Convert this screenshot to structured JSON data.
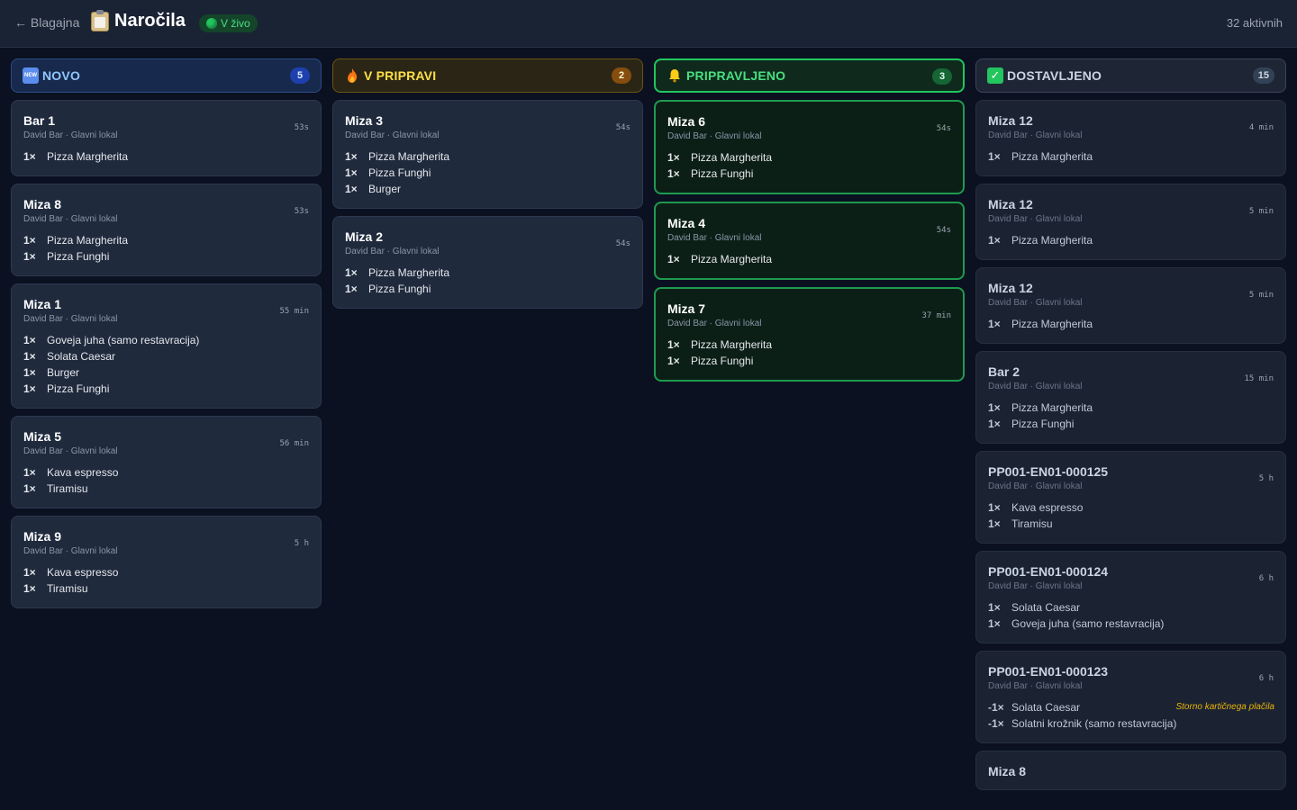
{
  "header": {
    "back_label": "← Blagajna",
    "title": "Naročila",
    "live_label": "V živo",
    "active_count": "32 aktivnih"
  },
  "columns": [
    {
      "label": "NOVO",
      "count": "5",
      "icon": "new-icon",
      "cards": [
        {
          "title": "Bar 1",
          "sub": "David Bar · Glavni lokal",
          "time": "53s",
          "items": [
            {
              "qty": "1×",
              "name": "Pizza Margherita"
            }
          ]
        },
        {
          "title": "Miza 8",
          "sub": "David Bar · Glavni lokal",
          "time": "53s",
          "items": [
            {
              "qty": "1×",
              "name": "Pizza Margherita"
            },
            {
              "qty": "1×",
              "name": "Pizza Funghi"
            }
          ]
        },
        {
          "title": "Miza 1",
          "sub": "David Bar · Glavni lokal",
          "time": "55 min",
          "items": [
            {
              "qty": "1×",
              "name": "Goveja juha (samo restavracija)"
            },
            {
              "qty": "1×",
              "name": "Solata Caesar"
            },
            {
              "qty": "1×",
              "name": "Burger"
            },
            {
              "qty": "1×",
              "name": "Pizza Funghi"
            }
          ]
        },
        {
          "title": "Miza 5",
          "sub": "David Bar · Glavni lokal",
          "time": "56 min",
          "items": [
            {
              "qty": "1×",
              "name": "Kava espresso"
            },
            {
              "qty": "1×",
              "name": "Tiramisu"
            }
          ]
        },
        {
          "title": "Miza 9",
          "sub": "David Bar · Glavni lokal",
          "time": "5 h",
          "items": [
            {
              "qty": "1×",
              "name": "Kava espresso"
            },
            {
              "qty": "1×",
              "name": "Tiramisu"
            }
          ]
        }
      ]
    },
    {
      "label": "V PRIPRAVI",
      "count": "2",
      "icon": "fire-icon",
      "cards": [
        {
          "title": "Miza 3",
          "sub": "David Bar · Glavni lokal",
          "time": "54s",
          "items": [
            {
              "qty": "1×",
              "name": "Pizza Margherita"
            },
            {
              "qty": "1×",
              "name": "Pizza Funghi"
            },
            {
              "qty": "1×",
              "name": "Burger"
            }
          ]
        },
        {
          "title": "Miza 2",
          "sub": "David Bar · Glavni lokal",
          "time": "54s",
          "items": [
            {
              "qty": "1×",
              "name": "Pizza Margherita"
            },
            {
              "qty": "1×",
              "name": "Pizza Funghi"
            }
          ]
        }
      ]
    },
    {
      "label": "PRIPRAVLJENO",
      "count": "3",
      "icon": "bell-icon",
      "cards": [
        {
          "title": "Miza 6",
          "sub": "David Bar · Glavni lokal",
          "time": "54s",
          "items": [
            {
              "qty": "1×",
              "name": "Pizza Margherita"
            },
            {
              "qty": "1×",
              "name": "Pizza Funghi"
            }
          ]
        },
        {
          "title": "Miza 4",
          "sub": "David Bar · Glavni lokal",
          "time": "54s",
          "items": [
            {
              "qty": "1×",
              "name": "Pizza Margherita"
            }
          ]
        },
        {
          "title": "Miza 7",
          "sub": "David Bar · Glavni lokal",
          "time": "37 min",
          "items": [
            {
              "qty": "1×",
              "name": "Pizza Margherita"
            },
            {
              "qty": "1×",
              "name": "Pizza Funghi"
            }
          ]
        }
      ]
    },
    {
      "label": "DOSTAVLJENO",
      "count": "15",
      "icon": "check-icon",
      "cards": [
        {
          "title": "Miza 12",
          "sub": "David Bar · Glavni lokal",
          "time": "4 min",
          "items": [
            {
              "qty": "1×",
              "name": "Pizza Margherita"
            }
          ]
        },
        {
          "title": "Miza 12",
          "sub": "David Bar · Glavni lokal",
          "time": "5 min",
          "items": [
            {
              "qty": "1×",
              "name": "Pizza Margherita"
            }
          ]
        },
        {
          "title": "Miza 12",
          "sub": "David Bar · Glavni lokal",
          "time": "5 min",
          "items": [
            {
              "qty": "1×",
              "name": "Pizza Margherita"
            }
          ]
        },
        {
          "title": "Bar 2",
          "sub": "David Bar · Glavni lokal",
          "time": "15 min",
          "items": [
            {
              "qty": "1×",
              "name": "Pizza Margherita"
            },
            {
              "qty": "1×",
              "name": "Pizza Funghi"
            }
          ]
        },
        {
          "title": "PP001-EN01-000125",
          "sub": "David Bar · Glavni lokal",
          "time": "5 h",
          "items": [
            {
              "qty": "1×",
              "name": "Kava espresso"
            },
            {
              "qty": "1×",
              "name": "Tiramisu"
            }
          ]
        },
        {
          "title": "PP001-EN01-000124",
          "sub": "David Bar · Glavni lokal",
          "time": "6 h",
          "items": [
            {
              "qty": "1×",
              "name": "Solata Caesar"
            },
            {
              "qty": "1×",
              "name": "Goveja juha (samo restavracija)"
            }
          ]
        },
        {
          "title": "PP001-EN01-000123",
          "sub": "David Bar · Glavni lokal",
          "time": "6 h",
          "note": "Storno kartičnega plačila",
          "items": [
            {
              "qty": "-1×",
              "name": "Solata Caesar"
            },
            {
              "qty": "-1×",
              "name": "Solatni krožnik (samo restavracija)"
            }
          ]
        },
        {
          "title": "Miza 8",
          "sub": "",
          "time": "",
          "items": []
        }
      ]
    }
  ]
}
